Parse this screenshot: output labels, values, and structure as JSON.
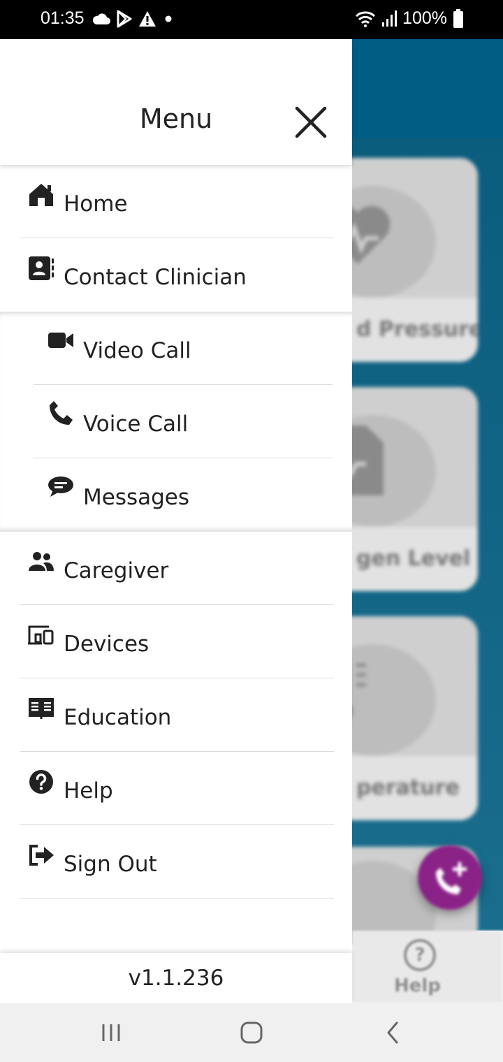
{
  "status_bar": {
    "time": "01:35",
    "left_icons": [
      "cloud-icon",
      "play-store-icon",
      "warning-icon",
      "dot-icon"
    ],
    "right_icons": [
      "wifi-icon",
      "signal-icon",
      "battery-icon"
    ],
    "battery": "100%"
  },
  "drawer": {
    "title": "Menu",
    "close_icon": "close-icon",
    "items": [
      {
        "label": "Home",
        "icon": "home-icon"
      },
      {
        "label": "Contact Clinician",
        "icon": "contact-card-icon"
      }
    ],
    "sub_items": [
      {
        "label": "Video Call",
        "icon": "video-camera-icon"
      },
      {
        "label": "Voice Call",
        "icon": "phone-icon"
      },
      {
        "label": "Messages",
        "icon": "chat-bubble-icon"
      }
    ],
    "bottom_items": [
      {
        "label": "Caregiver",
        "icon": "people-icon"
      },
      {
        "label": "Devices",
        "icon": "devices-icon"
      },
      {
        "label": "Education",
        "icon": "book-icon"
      },
      {
        "label": "Help",
        "icon": "question-circle-icon"
      },
      {
        "label": "Sign Out",
        "icon": "sign-out-icon"
      }
    ],
    "version": "v1.1.236"
  },
  "background": {
    "cards": [
      {
        "label": "d Pressure"
      },
      {
        "label": "gen Level"
      },
      {
        "label": "perature"
      }
    ],
    "bottom_nav_label": "Help",
    "fab_icon": "add-call-icon"
  },
  "nav_bar": {
    "recents": "recents-icon",
    "home": "home-circle-icon",
    "back": "back-icon"
  },
  "colors": {
    "header_blue": "#015d84",
    "fab_purple": "#8a2287",
    "text": "#222222"
  }
}
